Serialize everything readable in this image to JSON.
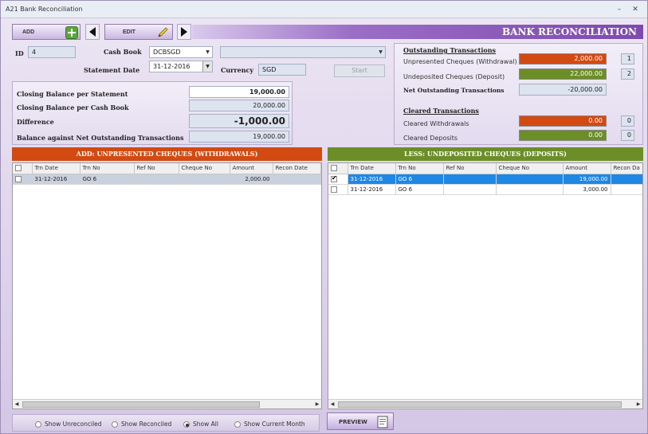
{
  "window": {
    "title": "A21 Bank Reconciliation",
    "minimize": "–",
    "close": "✕"
  },
  "toolbar": {
    "add_label": "ADD",
    "edit_label": "EDIT",
    "prev_icon": "triangle-left",
    "next_icon": "triangle-right"
  },
  "banner": {
    "title": "BANK RECONCILIATION"
  },
  "form": {
    "id_label": "ID",
    "id_value": "4",
    "cash_book_label": "Cash Book",
    "cash_book_value": "DCBSGD",
    "cash_book_desc": "",
    "statement_date_label": "Statement Date",
    "statement_date_value": "31-12-2016",
    "currency_label": "Currency",
    "currency_value": "SGD",
    "start_label": "Start"
  },
  "balances": {
    "closing_statement_label": "Closing Balance per Statement",
    "closing_statement_value": "19,000.00",
    "closing_cashbook_label": "Closing Balance per Cash Book",
    "closing_cashbook_value": "20,000.00",
    "difference_label": "Difference",
    "difference_value": "-1,000.00",
    "net_outstanding_label": "Balance against Net Outstanding Transactions",
    "net_outstanding_value": "19,000.00"
  },
  "outstanding": {
    "title": "Outstanding Transactions",
    "unpresented_label": "Unpresented Cheques (Withdrawal)",
    "unpresented_value": "2,000.00",
    "unpresented_count": "1",
    "undeposited_label": "Undeposited Cheques (Deposit)",
    "undeposited_value": "22,000.00",
    "undeposited_count": "2",
    "net_label": "Net Outstanding Transactions",
    "net_value": "-20,000.00",
    "cleared_title": "Cleared Transactions",
    "cleared_withdrawals_label": "Cleared Withdrawals",
    "cleared_withdrawals_value": "0.00",
    "cleared_withdrawals_count": "0",
    "cleared_deposits_label": "Cleared Deposits",
    "cleared_deposits_value": "0.00",
    "cleared_deposits_count": "0"
  },
  "left_grid": {
    "title": "ADD: UNPRESENTED CHEQUES (WITHDRAWALS)",
    "columns": [
      "Trn Date",
      "Trn No",
      "Ref No",
      "Cheque No",
      "Amount",
      "Recon Date"
    ],
    "rows": [
      {
        "date": "31-12-2016",
        "trn": "GO 6",
        "ref": "",
        "cheque": "",
        "amount": "2,000.00",
        "recon": ""
      }
    ]
  },
  "right_grid": {
    "title": "LESS: UNDEPOSITED CHEQUES (DEPOSITS)",
    "columns": [
      "Trn Date",
      "Trn No",
      "Ref No",
      "Cheque No",
      "Amount",
      "Recon Da"
    ],
    "rows": [
      {
        "date": "31-12-2016",
        "trn": "GO 6",
        "ref": "",
        "cheque": "",
        "amount": "19,000.00",
        "recon": ""
      },
      {
        "date": "31-12-2016",
        "trn": "GO 6",
        "ref": "",
        "cheque": "",
        "amount": "3,000.00",
        "recon": ""
      }
    ]
  },
  "filters": {
    "show_unreconciled": "Show Unreconciled",
    "show_reconciled": "Show Reconciled",
    "show_all": "Show All",
    "show_current_month": "Show Current Month",
    "selected": "Show All"
  },
  "preview": {
    "label": "PREVIEW"
  },
  "colors": {
    "orange": "#d24a12",
    "green": "#6c8e28",
    "purple": "#7d49ad",
    "selection": "#1f87e4"
  }
}
